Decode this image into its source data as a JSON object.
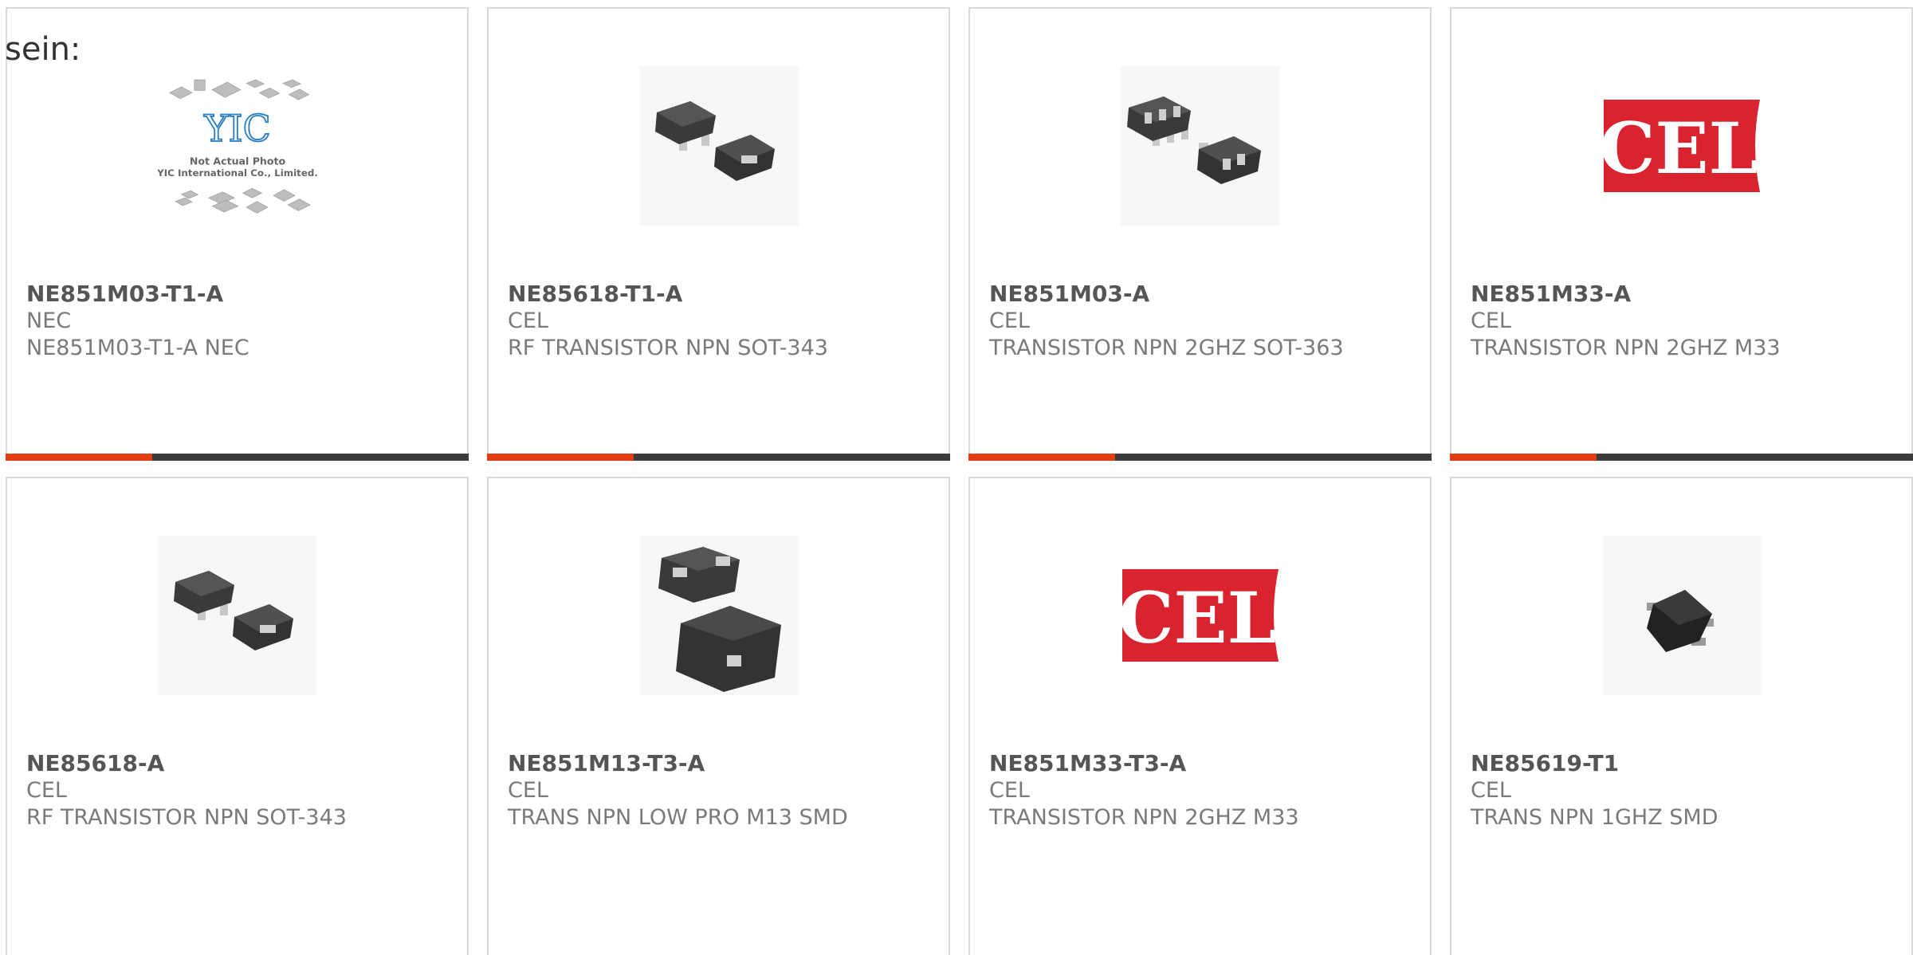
{
  "page": {
    "lead_text": "sein:"
  },
  "theme": {
    "accent": "#e23c12",
    "bar": "#3c3c3c",
    "cel_red": "#d9232e"
  },
  "products": [
    {
      "part": "NE851M03-T1-A",
      "mfr": "NEC",
      "desc": "NE851M03-T1-A NEC",
      "image": "yic-placeholder",
      "ph_brand": "YIC",
      "ph_line1": "Not Actual Photo",
      "ph_line2": "YIC International Co., Limited."
    },
    {
      "part": "NE85618-T1-A",
      "mfr": "CEL",
      "desc": "RF TRANSISTOR NPN SOT-343",
      "image": "sot343-chip-icon"
    },
    {
      "part": "NE851M03-A",
      "mfr": "CEL",
      "desc": "TRANSISTOR NPN 2GHZ SOT-363",
      "image": "sot363-chip-icon"
    },
    {
      "part": "NE851M33-A",
      "mfr": "CEL",
      "desc": "TRANSISTOR NPN 2GHZ M33",
      "image": "cel-logo",
      "logo_text": "CEL"
    },
    {
      "part": "NE85618-A",
      "mfr": "CEL",
      "desc": "RF TRANSISTOR NPN SOT-343",
      "image": "sot343-chip-icon"
    },
    {
      "part": "NE851M13-T3-A",
      "mfr": "CEL",
      "desc": "TRANS NPN LOW PRO M13 SMD",
      "image": "m13-chip-icon"
    },
    {
      "part": "NE851M33-T3-A",
      "mfr": "CEL",
      "desc": "TRANSISTOR NPN 2GHZ M33",
      "image": "cel-logo",
      "logo_text": "CEL"
    },
    {
      "part": "NE85619-T1",
      "mfr": "CEL",
      "desc": "TRANS NPN 1GHZ SMD",
      "image": "sot-chip-icon"
    }
  ]
}
